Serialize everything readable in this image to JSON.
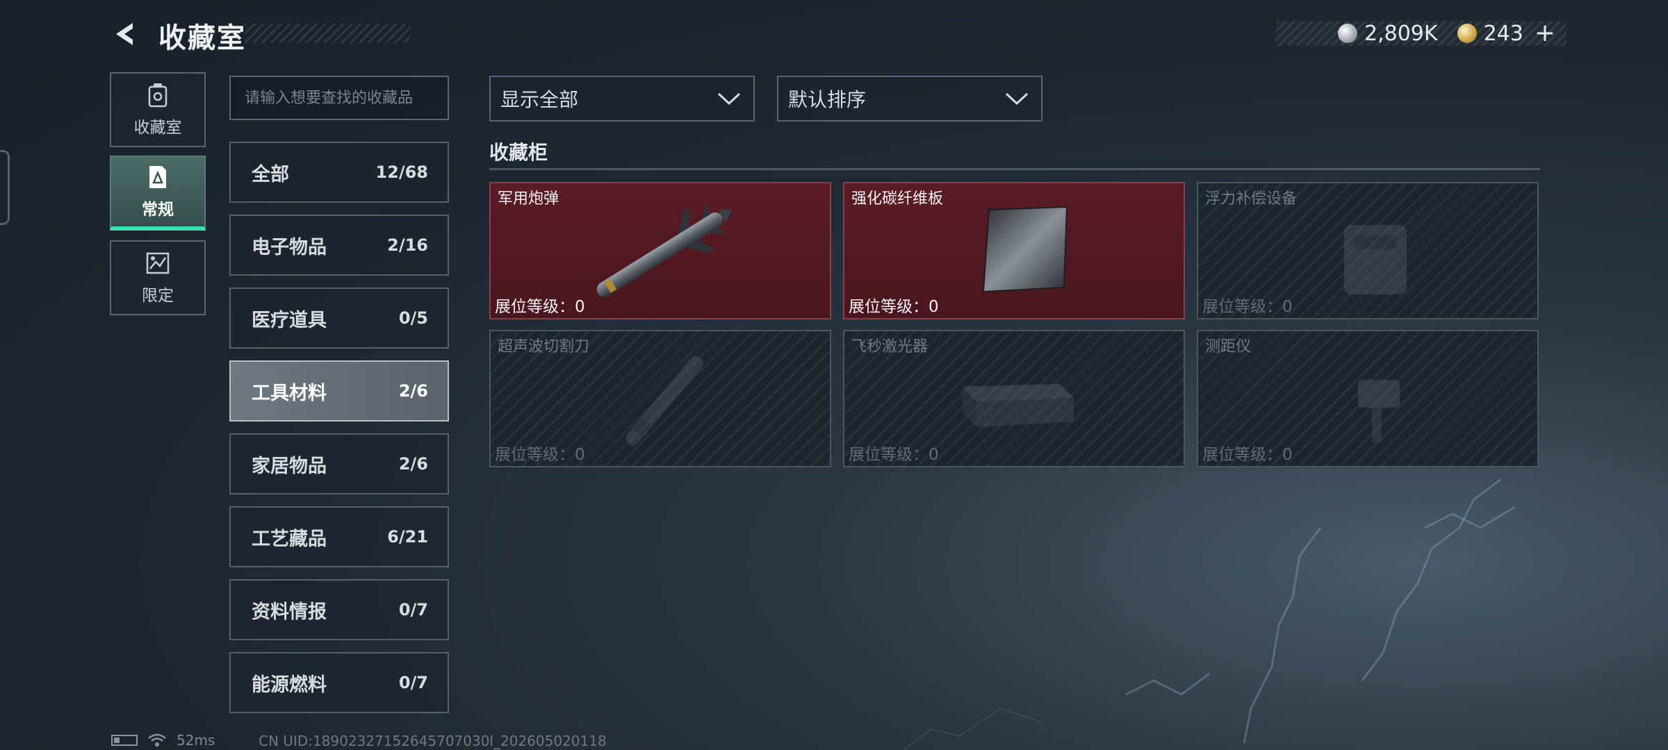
{
  "header": {
    "title": "收藏室",
    "silver_amount": "2,809K",
    "gold_amount": "243",
    "plus_label": "+"
  },
  "nav": [
    {
      "label": "收藏室",
      "icon": "collection-room-icon",
      "active": false
    },
    {
      "label": "常规",
      "icon": "regular-icon",
      "active": true
    },
    {
      "label": "限定",
      "icon": "limited-icon",
      "active": false
    }
  ],
  "search": {
    "placeholder": "请输入想要查找的收藏品"
  },
  "categories": [
    {
      "name": "全部",
      "count": "12/68"
    },
    {
      "name": "电子物品",
      "count": "2/16"
    },
    {
      "name": "医疗道具",
      "count": "0/5"
    },
    {
      "name": "工具材料",
      "count": "2/6",
      "active": true
    },
    {
      "name": "家居物品",
      "count": "2/6"
    },
    {
      "name": "工艺藏品",
      "count": "6/21"
    },
    {
      "name": "资料情报",
      "count": "0/7"
    },
    {
      "name": "能源燃料",
      "count": "0/7"
    }
  ],
  "filters": {
    "display_label": "显示全部",
    "sort_label": "默认排序"
  },
  "section_title": "收藏柜",
  "items": [
    {
      "name": "军用炮弹",
      "level_text": "展位等级：0",
      "owned": true,
      "icon": "missile-icon"
    },
    {
      "name": "强化碳纤维板",
      "level_text": "展位等级：0",
      "owned": true,
      "icon": "carbon-plate-icon"
    },
    {
      "name": "浮力补偿设备",
      "level_text": "展位等级：0",
      "owned": false,
      "icon": "buoyancy-device-icon"
    },
    {
      "name": "超声波切割刀",
      "level_text": "展位等级：0",
      "owned": false,
      "icon": "ultrasonic-cutter-icon"
    },
    {
      "name": "飞秒激光器",
      "level_text": "展位等级：0",
      "owned": false,
      "icon": "femtosecond-laser-icon"
    },
    {
      "name": "测距仪",
      "level_text": "展位等级：0",
      "owned": false,
      "icon": "rangefinder-icon"
    }
  ],
  "status": {
    "ping": "52ms",
    "uid": "CN UID:18902327152645707030l_202605020118"
  },
  "colors": {
    "active_accent": "#2ee5b0",
    "owned_card": "#5a1c24"
  }
}
